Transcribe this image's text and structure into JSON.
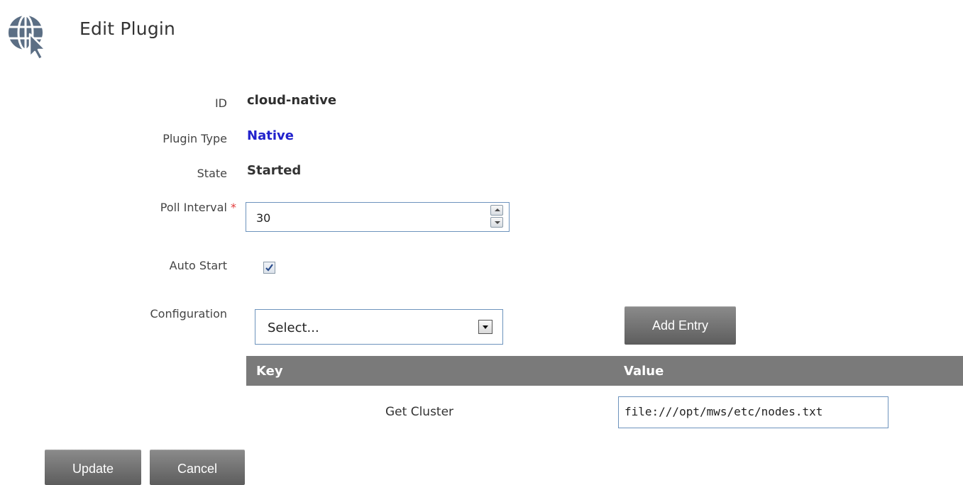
{
  "header": {
    "title": "Edit Plugin",
    "icon": "globe-cursor-icon"
  },
  "form": {
    "id": {
      "label": "ID",
      "value": "cloud-native"
    },
    "plugin_type": {
      "label": "Plugin Type",
      "value": "Native"
    },
    "state": {
      "label": "State",
      "value": "Started"
    },
    "poll_interval": {
      "label": "Poll Interval",
      "required_marker": "*",
      "value": "30"
    },
    "auto_start": {
      "label": "Auto Start",
      "checked": true
    },
    "configuration": {
      "label": "Configuration",
      "select_value": "Select...",
      "add_entry_label": "Add Entry"
    }
  },
  "table": {
    "columns": [
      "Key",
      "Value"
    ],
    "rows": [
      {
        "key": "Get Cluster",
        "value": "file:///opt/mws/etc/nodes.txt"
      }
    ]
  },
  "actions": {
    "update_label": "Update",
    "cancel_label": "Cancel"
  },
  "colors": {
    "plugin_type_value": "#2222cc",
    "required_marker": "#e23b3b",
    "button_bg": "#6e6e6e",
    "table_header_bg": "#7a7a7a",
    "input_border": "#6d93bd",
    "icon": "#5b6e84"
  }
}
